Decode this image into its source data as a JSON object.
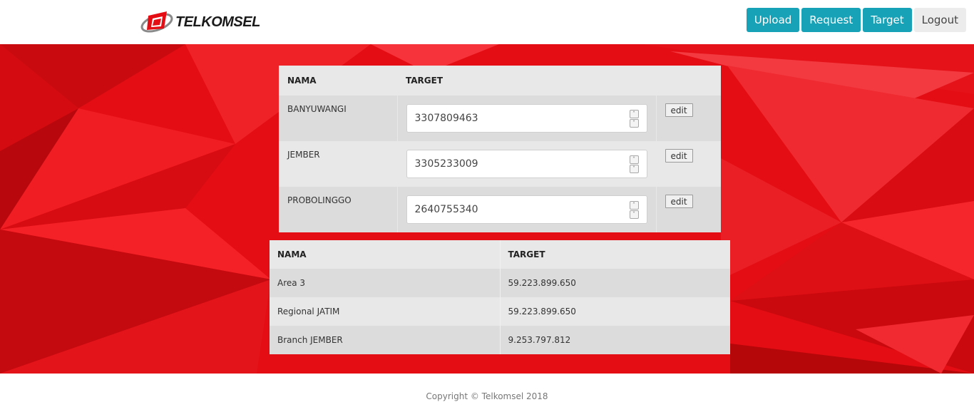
{
  "header": {
    "logo_text": "TELKOMSEL",
    "nav": [
      {
        "label": "Upload"
      },
      {
        "label": "Request"
      },
      {
        "label": "Target"
      },
      {
        "label": "Logout"
      }
    ]
  },
  "edit_table": {
    "columns": [
      "NAMA",
      "TARGET",
      ""
    ],
    "rows": [
      {
        "name": "BANYUWANGI",
        "target": "3307809463",
        "action": "edit"
      },
      {
        "name": "JEMBER",
        "target": "3305233009",
        "action": "edit"
      },
      {
        "name": "PROBOLINGGO",
        "target": "2640755340",
        "action": "edit"
      }
    ]
  },
  "summary_table": {
    "columns": [
      "NAMA",
      "TARGET"
    ],
    "rows": [
      {
        "name": "Area 3",
        "target": "59.223.899.650"
      },
      {
        "name": "Regional JATIM",
        "target": "59.223.899.650"
      },
      {
        "name": "Branch JEMBER",
        "target": "9.253.797.812"
      }
    ]
  },
  "footer": {
    "copyright": "Copyright © Telkomsel 2018"
  },
  "colors": {
    "accent": "#17a2b8",
    "banner_red": "#e30d13"
  },
  "icons": {
    "spinner_up": "chevron-up-icon",
    "spinner_down": "chevron-down-icon"
  }
}
